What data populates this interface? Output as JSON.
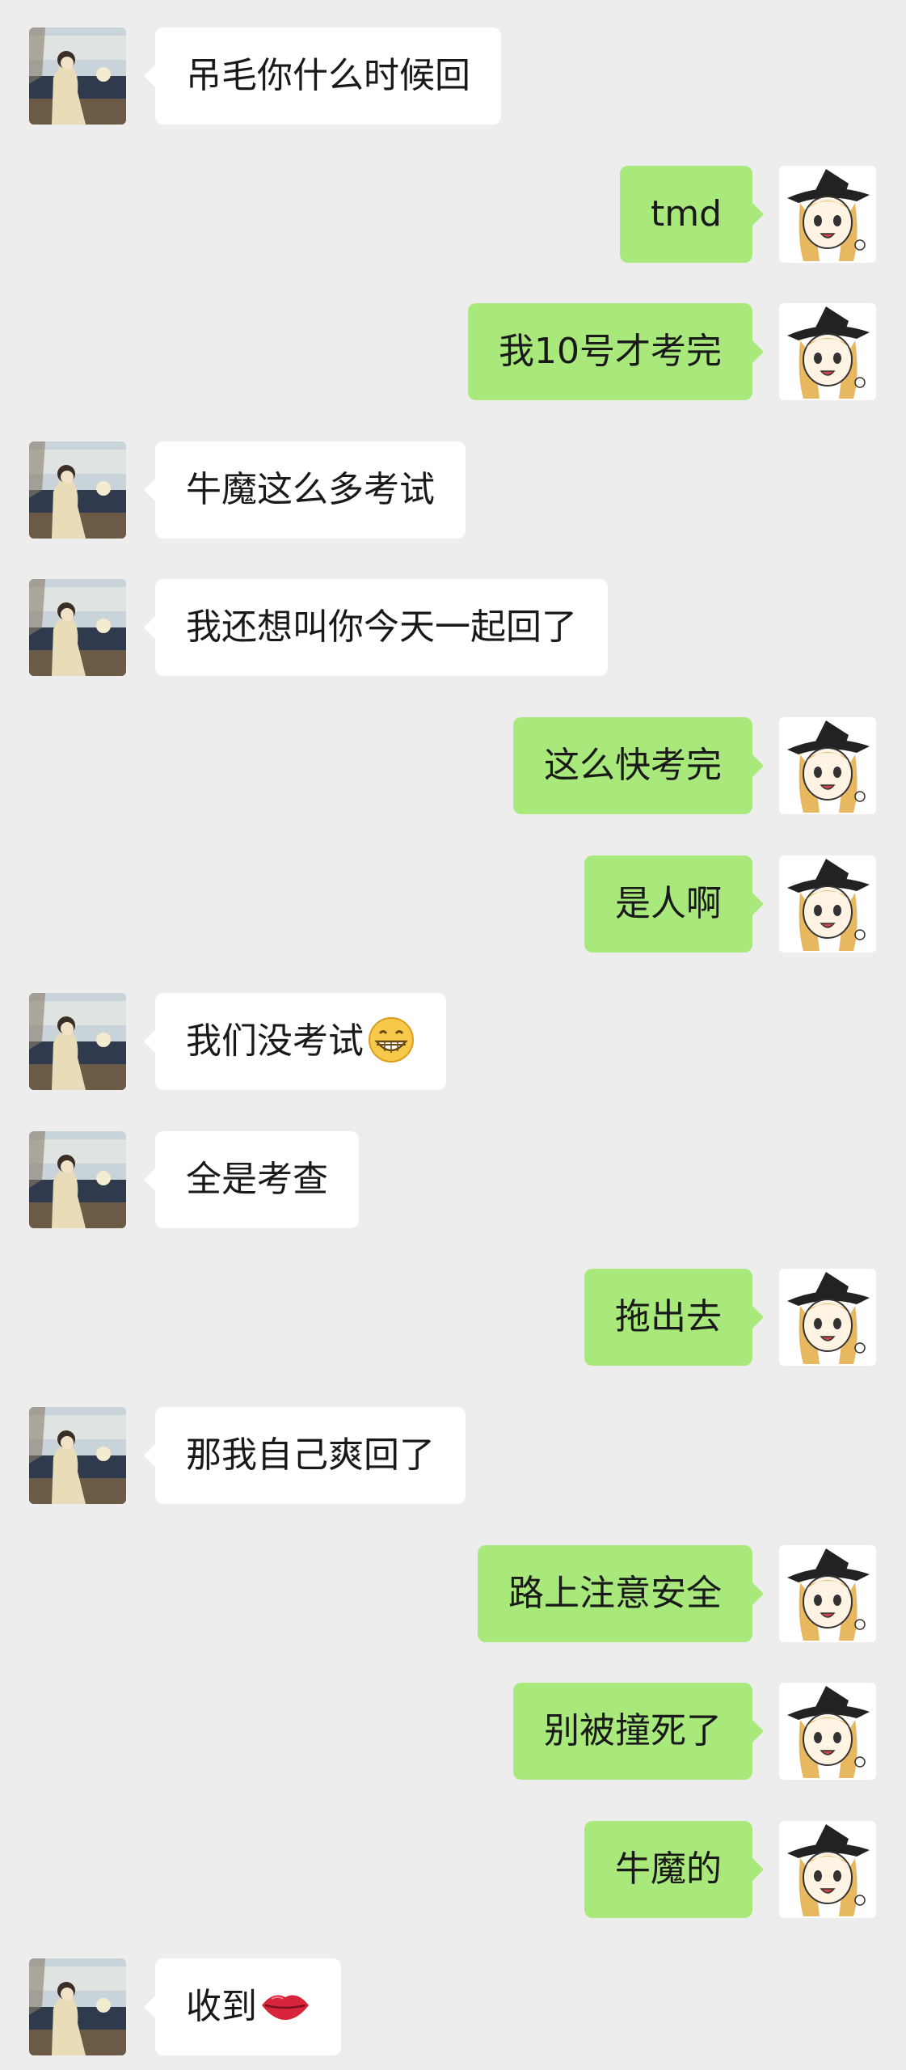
{
  "messages": [
    {
      "from": "other",
      "text": "吊毛你什么时候回"
    },
    {
      "from": "me",
      "text": "tmd"
    },
    {
      "from": "me",
      "text": "我10号才考完"
    },
    {
      "from": "other",
      "text": "牛魔这么多考试"
    },
    {
      "from": "other",
      "text": "我还想叫你今天一起回了"
    },
    {
      "from": "me",
      "text": "这么快考完"
    },
    {
      "from": "me",
      "text": "是人啊"
    },
    {
      "from": "other",
      "text": "我们没考试",
      "emoji": "grinning-face-emoji"
    },
    {
      "from": "other",
      "text": "全是考查"
    },
    {
      "from": "me",
      "text": "拖出去"
    },
    {
      "from": "other",
      "text": "那我自己爽回了"
    },
    {
      "from": "me",
      "text": "路上注意安全"
    },
    {
      "from": "me",
      "text": "别被撞死了"
    },
    {
      "from": "me",
      "text": "牛魔的"
    },
    {
      "from": "other",
      "text": "收到",
      "emoji": "lips-emoji"
    }
  ],
  "avatars": {
    "other": "anime-figure-seaside-avatar",
    "me": "witch-girl-avatar"
  },
  "colors": {
    "background": "#ededed",
    "sent_bubble": "#a9e97c",
    "received_bubble": "#ffffff",
    "text": "#191919"
  }
}
